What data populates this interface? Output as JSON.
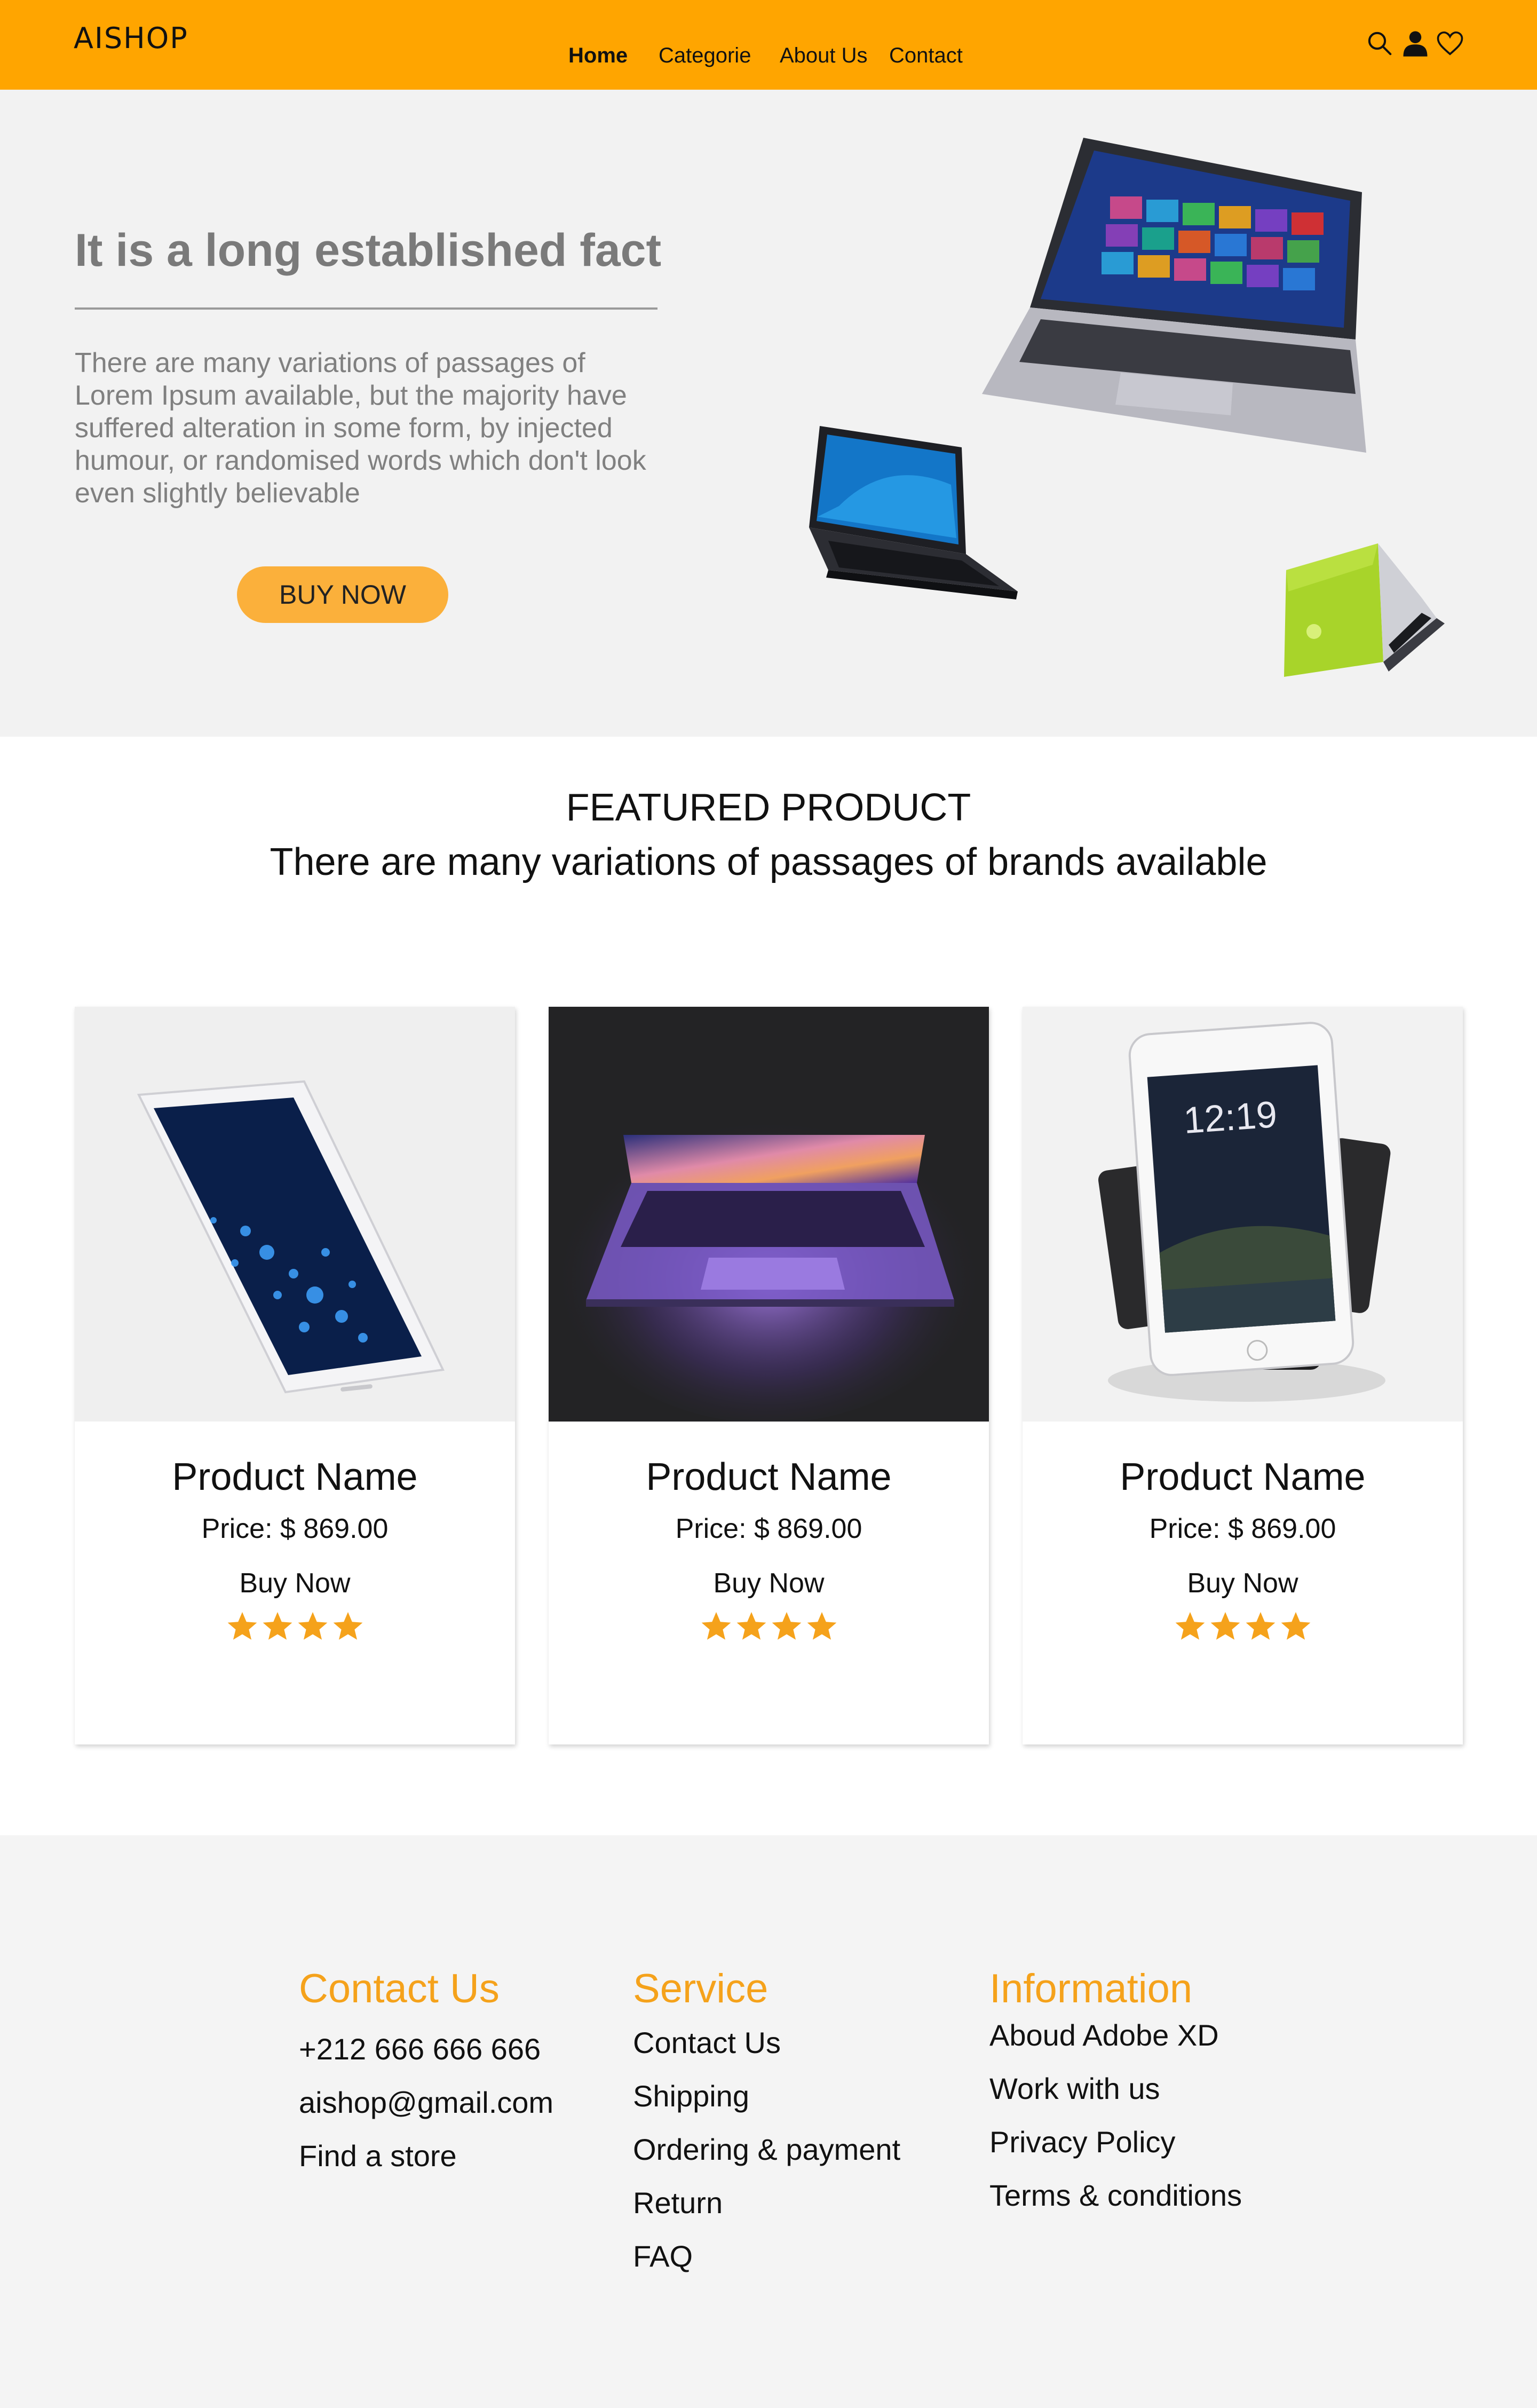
{
  "header": {
    "logo": "AISHOP",
    "nav": [
      "Home",
      "Categorie",
      "About Us",
      "Contact"
    ],
    "icons": [
      "search-icon",
      "user-icon",
      "heart-icon"
    ],
    "bg_color": "#ffa500"
  },
  "hero": {
    "title": "It is a long established fact",
    "text": "There are many variations of passages of Lorem Ipsum available, but the majority have suffered alteration in some form, by injected humour, or randomised words which don't look even slightly believable",
    "button": "BUY NOW",
    "button_color": "#fbb03b"
  },
  "featured": {
    "title": "FEATURED PRODUCT",
    "subtitle": "There are many variations of passages of brands available"
  },
  "products": [
    {
      "name": "Product Name",
      "price": "Price: $ 869.00",
      "buy": "Buy Now",
      "rating": 4
    },
    {
      "name": "Product Name",
      "price": "Price: $ 869.00",
      "buy": "Buy Now",
      "rating": 4
    },
    {
      "name": "Product Name",
      "price": "Price: $ 869.00",
      "buy": "Buy Now",
      "rating": 4
    }
  ],
  "footer": {
    "contact": {
      "title": "Contact Us",
      "items": [
        "+212 666 666 666",
        "aishop@gmail.com",
        "Find a store"
      ]
    },
    "service": {
      "title": "Service",
      "items": [
        "Contact Us",
        "Shipping",
        "Ordering & payment",
        "Return",
        "FAQ"
      ]
    },
    "information": {
      "title": "Information",
      "items": [
        "Aboud Adobe XD",
        "Work with us",
        "Privacy Policy",
        "Terms & conditions"
      ]
    },
    "accent_color": "#f5a21b"
  }
}
